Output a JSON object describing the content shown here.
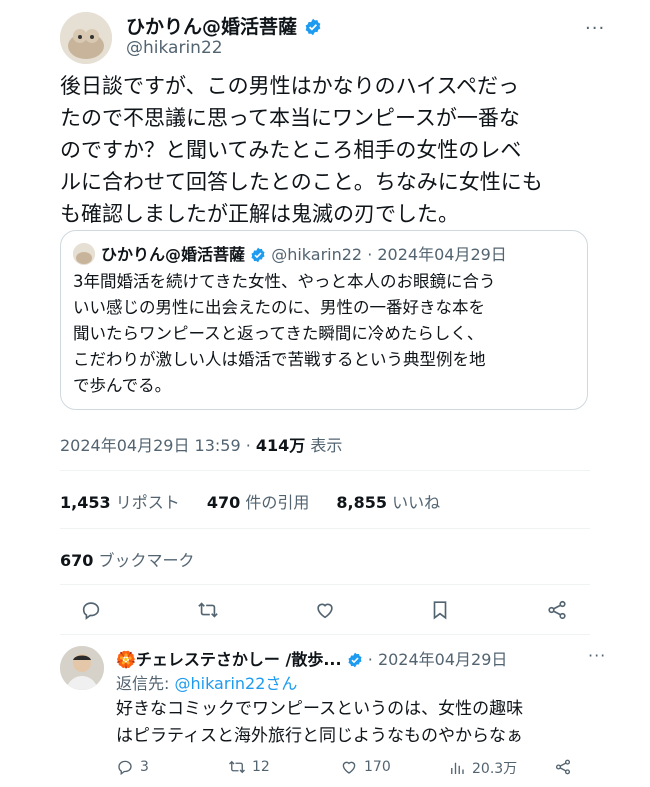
{
  "tweet": {
    "display_name": "ひかりん@婚活菩薩",
    "handle": "@hikarin22",
    "body_lines": [
      "後日談ですが、この男性はかなりのハイスペだっ",
      "たので不思議に思って本当にワンピースが一番な",
      "のですか？と聞いてみたところ相手の女性のレベ",
      "ルに合わせて回答したとのこと。ちなみに女性にも",
      "も確認しましたが正解は鬼滅の刃でした。"
    ],
    "quote": {
      "display_name": "ひかりん@婚活菩薩",
      "handle_date": "@hikarin22 · 2024年04月29日",
      "body_lines": [
        "3年間婚活を続けてきた女性、やっと本人のお眼鏡に合う",
        "いい感じの男性に出会えたのに、男性の一番好きな本を",
        "聞いたらワンピースと返ってきた瞬間に冷めたらしく、",
        "こだわりが激しい人は婚活で苦戦するという典型例を地",
        "で歩んでる。"
      ]
    },
    "timestamp": "2024年04月29日 13:59 · ",
    "views_count": "414万",
    "views_label": " 表示",
    "stats": {
      "retweets_count": "1,453",
      "retweets_label": "リポスト",
      "quotes_count": "470",
      "quotes_label": "件の引用",
      "likes_count": "8,855",
      "likes_label": "いいね",
      "bookmarks_count": "670",
      "bookmarks_label": "ブックマーク"
    }
  },
  "reply": {
    "display_name": "🏵️チェレステさかしー /散歩...",
    "date": "· 2024年04月29日",
    "reply_to_label": "返信先: ",
    "reply_to_handle": "@hikarin22さん",
    "body_lines": [
      "好きなコミックでワンピースというのは、女性の趣味",
      "はピラティスと海外旅行と同じようなものやからなぁ"
    ],
    "replies": "3",
    "retweets": "12",
    "likes": "170",
    "views": "20.3万"
  },
  "colors": {
    "accent": "#1d9bf0",
    "text": "#0f1419",
    "muted": "#536471"
  },
  "icons": [
    "verified-badge-icon",
    "more-icon",
    "reply-icon",
    "retweet-icon",
    "like-icon",
    "bookmark-icon",
    "share-icon",
    "views-icon"
  ]
}
